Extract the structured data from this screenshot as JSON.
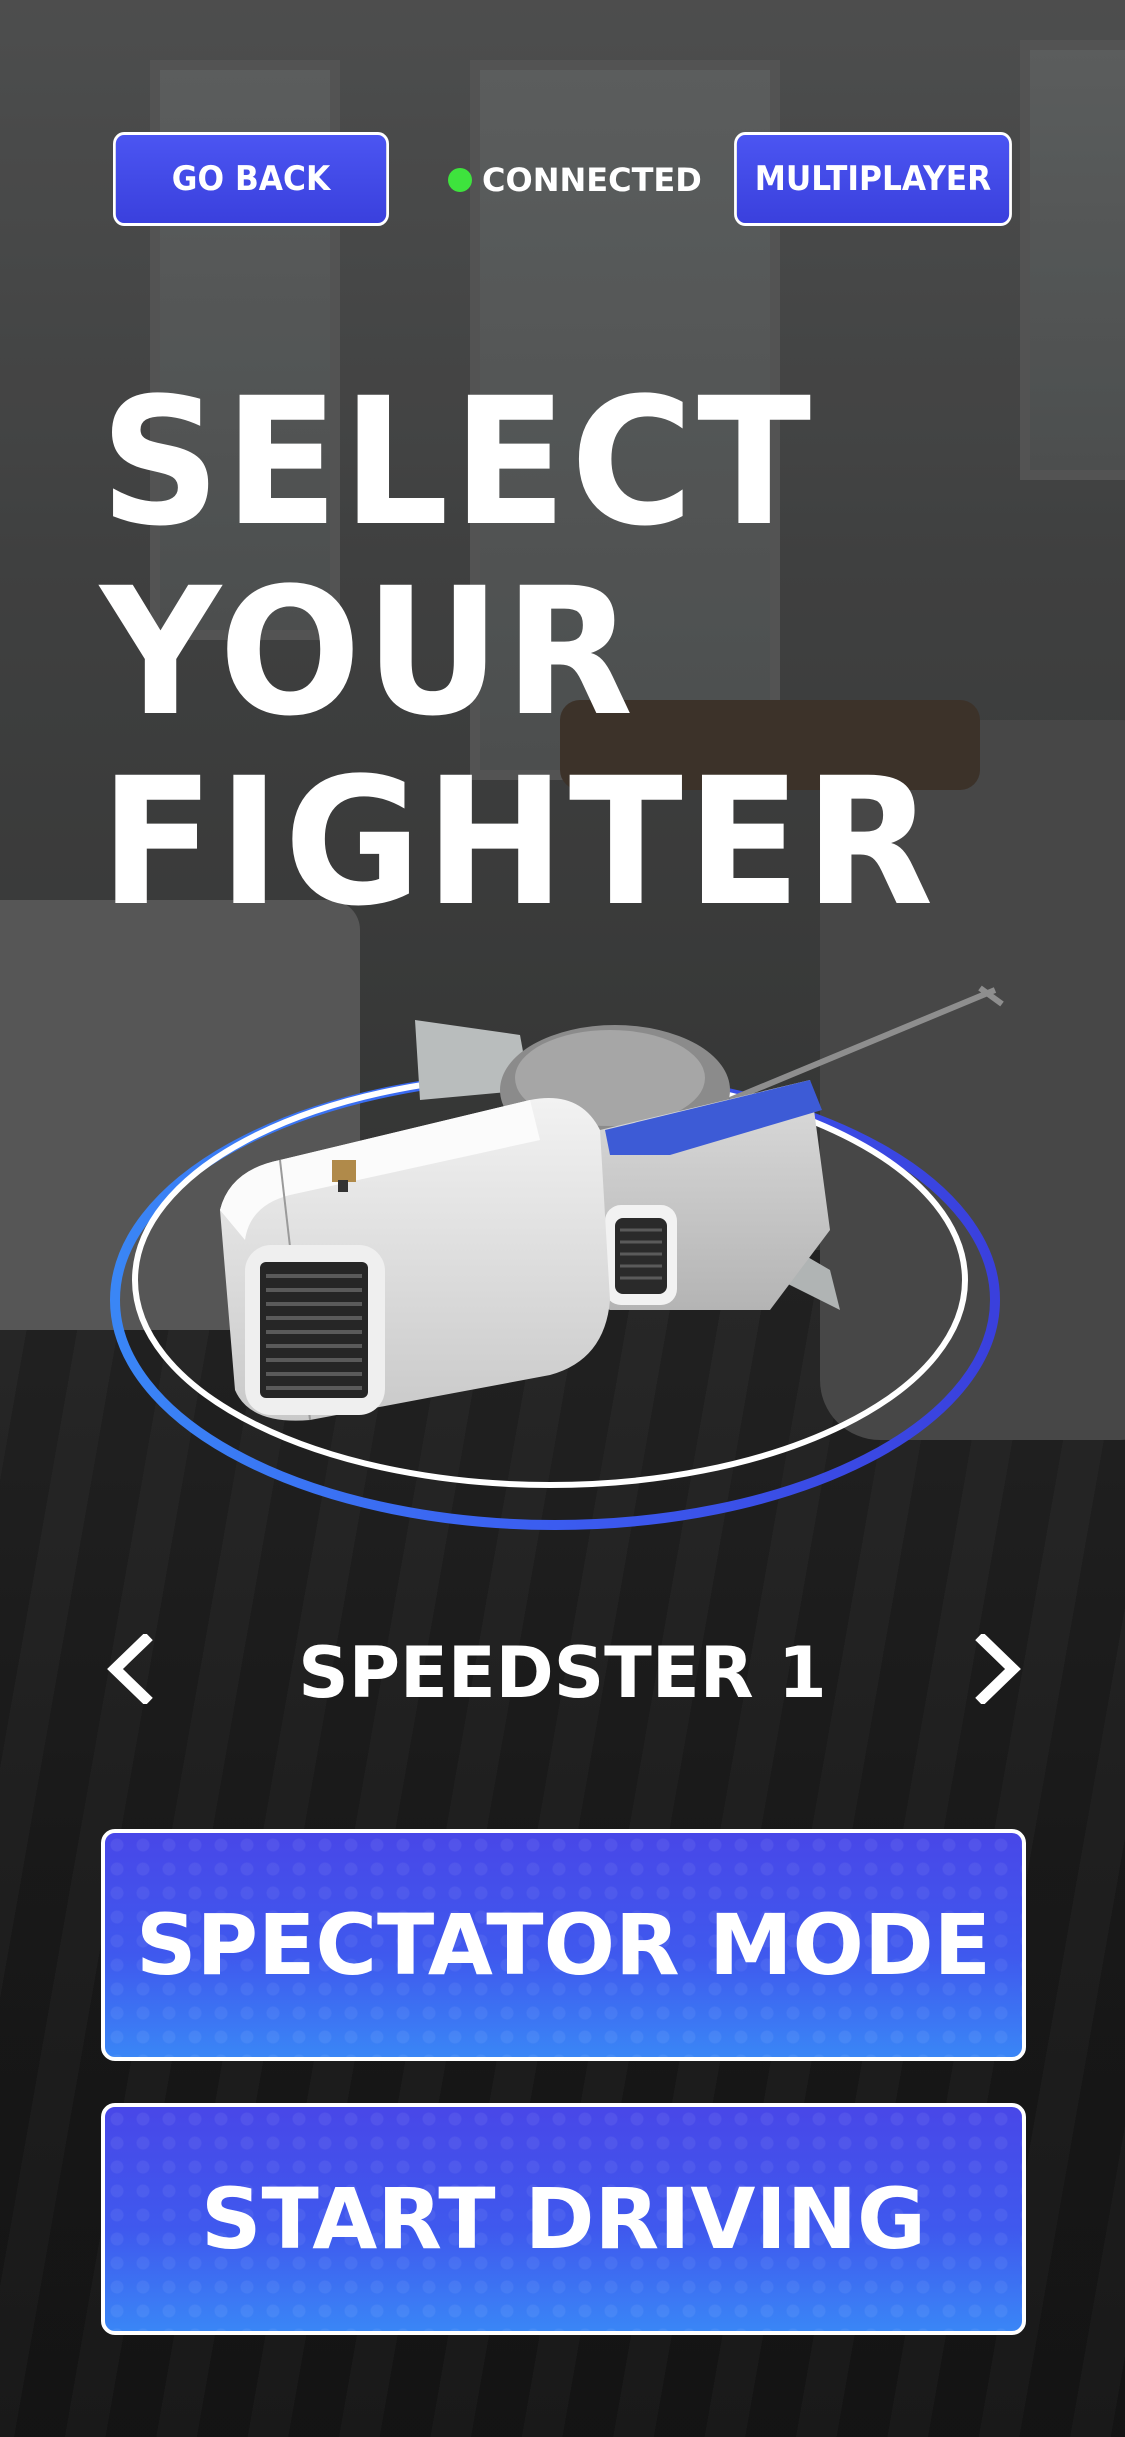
{
  "top_bar": {
    "go_back_label": "GO BACK",
    "status_text": "CONNECTED",
    "status_color": "#3ee33d",
    "multiplayer_label": "MULTIPLAYER"
  },
  "title": {
    "line1": "SELECT",
    "line2": "YOUR",
    "line3": "FIGHTER"
  },
  "selector": {
    "fighter_name": "SPEEDSTER 1",
    "prev_icon": "chevron-left-icon",
    "next_icon": "chevron-right-icon"
  },
  "actions": {
    "spectator_label": "SPECTATOR MODE",
    "start_label": "START DRIVING"
  },
  "colors": {
    "button_top": "#4847e8",
    "button_bottom": "#3a86f6",
    "ring_blue": "#3b5cf0"
  }
}
